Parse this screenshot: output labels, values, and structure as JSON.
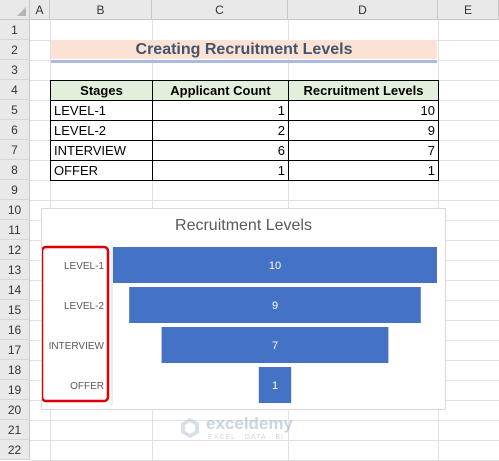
{
  "sheet": {
    "columns": [
      "A",
      "B",
      "C",
      "D",
      "E"
    ],
    "rows": [
      "1",
      "2",
      "3",
      "4",
      "5",
      "6",
      "7",
      "8",
      "9",
      "10",
      "11",
      "12",
      "13",
      "14",
      "15",
      "16",
      "17",
      "18",
      "19",
      "20",
      "21",
      "22"
    ]
  },
  "title": "Creating Recruitment Levels",
  "table": {
    "headers": [
      "Stages",
      "Applicant Count",
      "Recruitment Levels"
    ],
    "rows": [
      [
        "LEVEL-1",
        "1",
        "10"
      ],
      [
        "LEVEL-2",
        "2",
        "9"
      ],
      [
        "INTERVIEW",
        "6",
        "7"
      ],
      [
        "OFFER",
        "1",
        "1"
      ]
    ]
  },
  "chart_data": {
    "type": "bar",
    "subtype": "funnel",
    "title": "Recruitment Levels",
    "categories": [
      "LEVEL-1",
      "LEVEL-2",
      "INTERVIEW",
      "OFFER"
    ],
    "values": [
      10,
      9,
      7,
      1
    ],
    "bar_color": "#4472c4",
    "label_color": "#ffffff",
    "highlight_color": "#e00000",
    "legend": "none",
    "grid": false
  },
  "watermark": {
    "name": "exceldemy",
    "tagline": "EXCEL · DATA · BI"
  },
  "colors": {
    "title_text": "#44546a",
    "title_fill": "#fbe2d5",
    "header_fill": "#e2efda"
  }
}
